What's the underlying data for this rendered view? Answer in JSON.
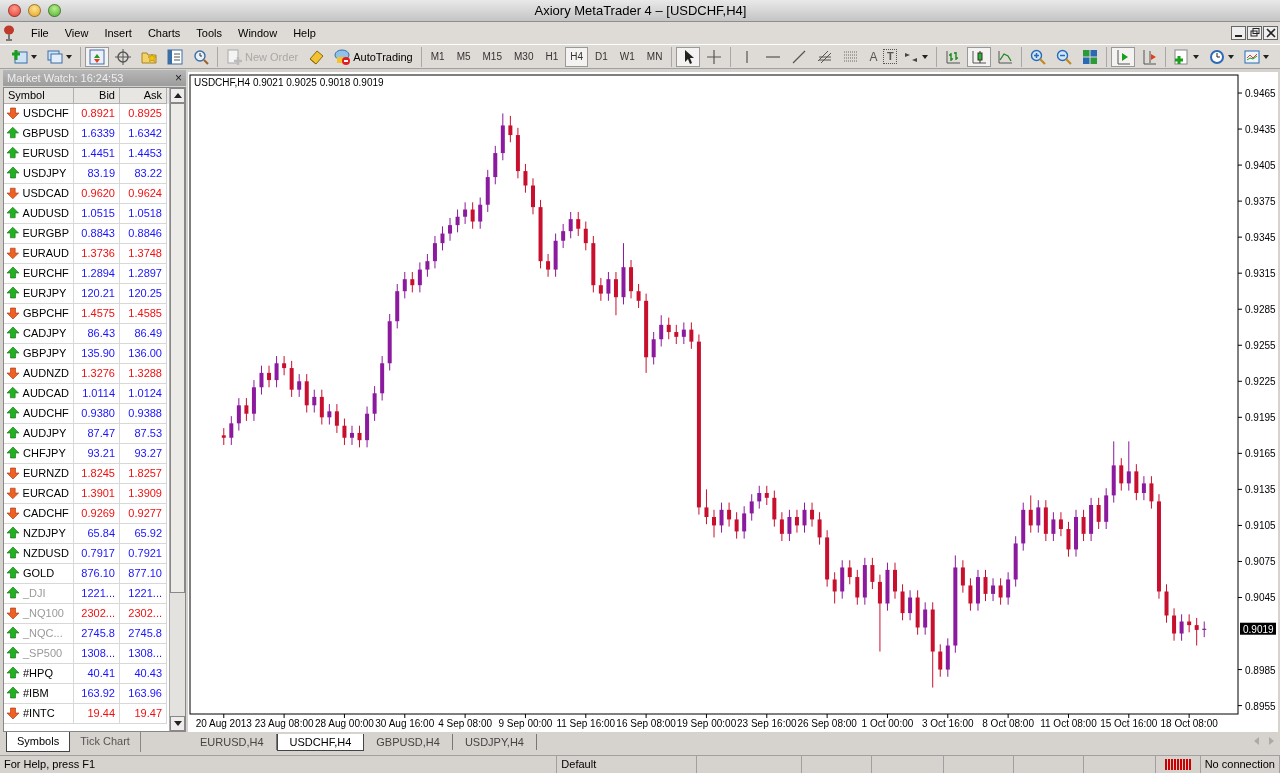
{
  "window": {
    "title": "Axiory MetaTrader 4 – [USDCHF,H4]"
  },
  "menu": [
    "File",
    "View",
    "Insert",
    "Charts",
    "Tools",
    "Window",
    "Help"
  ],
  "toolbar": [
    [
      {
        "kind": "new_chart",
        "dropdown": true,
        "pressed": false
      },
      {
        "kind": "profiles",
        "dropdown": true,
        "pressed": false
      }
    ],
    [
      {
        "kind": "market_watch",
        "pressed": true
      },
      {
        "kind": "data_window",
        "pressed": false
      },
      {
        "kind": "navigator",
        "pressed": false
      },
      {
        "kind": "terminal",
        "pressed": false
      },
      {
        "kind": "tester",
        "pressed": false
      }
    ],
    [
      {
        "kind": "new_order",
        "label": "New Order",
        "disabled": true
      },
      {
        "kind": "editor",
        "pressed": false
      },
      {
        "kind": "autotrading",
        "label": "AutoTrading",
        "disabled": false
      }
    ],
    [
      {
        "kind": "timeframe",
        "label": "M1",
        "selected": false
      },
      {
        "kind": "timeframe",
        "label": "M5",
        "selected": false
      },
      {
        "kind": "timeframe",
        "label": "M15",
        "selected": false
      },
      {
        "kind": "timeframe",
        "label": "M30",
        "selected": false
      },
      {
        "kind": "timeframe",
        "label": "H1",
        "selected": false
      },
      {
        "kind": "timeframe",
        "label": "H4",
        "selected": true
      },
      {
        "kind": "timeframe",
        "label": "D1",
        "selected": false
      },
      {
        "kind": "timeframe",
        "label": "W1",
        "selected": false
      },
      {
        "kind": "timeframe",
        "label": "MN",
        "selected": false
      }
    ],
    [
      {
        "kind": "cursor",
        "pressed": true
      },
      {
        "kind": "crosshair",
        "pressed": false
      }
    ],
    [
      {
        "kind": "vertical_line",
        "pressed": false
      },
      {
        "kind": "horizontal_line",
        "pressed": false
      },
      {
        "kind": "trendline",
        "pressed": false
      },
      {
        "kind": "channel",
        "pressed": false
      },
      {
        "kind": "levels",
        "pressed": false
      },
      {
        "kind": "text_label",
        "label": "A"
      },
      {
        "kind": "text_box",
        "label": "T"
      },
      {
        "kind": "arrows",
        "dropdown": true,
        "pressed": false
      }
    ],
    [
      {
        "kind": "bar_chart",
        "pressed": false
      },
      {
        "kind": "candlesticks",
        "pressed": true
      },
      {
        "kind": "line_chart",
        "pressed": false
      }
    ],
    [
      {
        "kind": "zoom_in",
        "pressed": false
      },
      {
        "kind": "zoom_out",
        "pressed": false
      },
      {
        "kind": "tile",
        "pressed": false
      }
    ],
    [
      {
        "kind": "chart_shift",
        "pressed": true
      },
      {
        "kind": "autoscroll",
        "pressed": false
      }
    ],
    [
      {
        "kind": "indicators",
        "dropdown": true,
        "pressed": false
      },
      {
        "kind": "periods",
        "dropdown": true,
        "pressed": false
      },
      {
        "kind": "templates",
        "dropdown": true,
        "pressed": false
      }
    ]
  ],
  "market_watch": {
    "title": "Market Watch: 16:24:53",
    "close": "×",
    "columns": [
      "Symbol",
      "Bid",
      "Ask"
    ],
    "rows": [
      {
        "symbol": "USDCHF",
        "bid": "0.8921",
        "ask": "0.8925",
        "up": false,
        "disabled": false
      },
      {
        "symbol": "GBPUSD",
        "bid": "1.6339",
        "ask": "1.6342",
        "up": true,
        "disabled": false
      },
      {
        "symbol": "EURUSD",
        "bid": "1.4451",
        "ask": "1.4453",
        "up": true,
        "disabled": false
      },
      {
        "symbol": "USDJPY",
        "bid": "83.19",
        "ask": "83.22",
        "up": true,
        "disabled": false
      },
      {
        "symbol": "USDCAD",
        "bid": "0.9620",
        "ask": "0.9624",
        "up": false,
        "disabled": false
      },
      {
        "symbol": "AUDUSD",
        "bid": "1.0515",
        "ask": "1.0518",
        "up": true,
        "disabled": false
      },
      {
        "symbol": "EURGBP",
        "bid": "0.8843",
        "ask": "0.8846",
        "up": true,
        "disabled": false
      },
      {
        "symbol": "EURAUD",
        "bid": "1.3736",
        "ask": "1.3748",
        "up": false,
        "disabled": false
      },
      {
        "symbol": "EURCHF",
        "bid": "1.2894",
        "ask": "1.2897",
        "up": true,
        "disabled": false
      },
      {
        "symbol": "EURJPY",
        "bid": "120.21",
        "ask": "120.25",
        "up": true,
        "disabled": false
      },
      {
        "symbol": "GBPCHF",
        "bid": "1.4575",
        "ask": "1.4585",
        "up": false,
        "disabled": false
      },
      {
        "symbol": "CADJPY",
        "bid": "86.43",
        "ask": "86.49",
        "up": true,
        "disabled": false
      },
      {
        "symbol": "GBPJPY",
        "bid": "135.90",
        "ask": "136.00",
        "up": true,
        "disabled": false
      },
      {
        "symbol": "AUDNZD",
        "bid": "1.3276",
        "ask": "1.3288",
        "up": false,
        "disabled": false
      },
      {
        "symbol": "AUDCAD",
        "bid": "1.0114",
        "ask": "1.0124",
        "up": true,
        "disabled": false
      },
      {
        "symbol": "AUDCHF",
        "bid": "0.9380",
        "ask": "0.9388",
        "up": true,
        "disabled": false
      },
      {
        "symbol": "AUDJPY",
        "bid": "87.47",
        "ask": "87.53",
        "up": true,
        "disabled": false
      },
      {
        "symbol": "CHFJPY",
        "bid": "93.21",
        "ask": "93.27",
        "up": true,
        "disabled": false
      },
      {
        "symbol": "EURNZD",
        "bid": "1.8245",
        "ask": "1.8257",
        "up": false,
        "disabled": false
      },
      {
        "symbol": "EURCAD",
        "bid": "1.3901",
        "ask": "1.3909",
        "up": false,
        "disabled": false
      },
      {
        "symbol": "CADCHF",
        "bid": "0.9269",
        "ask": "0.9277",
        "up": false,
        "disabled": false
      },
      {
        "symbol": "NZDJPY",
        "bid": "65.84",
        "ask": "65.92",
        "up": true,
        "disabled": false
      },
      {
        "symbol": "NZDUSD",
        "bid": "0.7917",
        "ask": "0.7921",
        "up": true,
        "disabled": false
      },
      {
        "symbol": "GOLD",
        "bid": "876.10",
        "ask": "877.10",
        "up": true,
        "disabled": false
      },
      {
        "symbol": "_DJI",
        "bid": "1221...",
        "ask": "1221...",
        "up": true,
        "disabled": true
      },
      {
        "symbol": "_NQ100",
        "bid": "2302...",
        "ask": "2302...",
        "up": false,
        "disabled": true
      },
      {
        "symbol": "_NQC...",
        "bid": "2745.8",
        "ask": "2745.8",
        "up": true,
        "disabled": true
      },
      {
        "symbol": "_SP500",
        "bid": "1308...",
        "ask": "1308...",
        "up": true,
        "disabled": true
      },
      {
        "symbol": "#HPQ",
        "bid": "40.41",
        "ask": "40.43",
        "up": true,
        "disabled": false
      },
      {
        "symbol": "#IBM",
        "bid": "163.92",
        "ask": "163.96",
        "up": true,
        "disabled": false
      },
      {
        "symbol": "#INTC",
        "bid": "19.44",
        "ask": "19.47",
        "up": false,
        "disabled": false
      }
    ],
    "tabs": [
      {
        "label": "Symbols",
        "selected": true
      },
      {
        "label": "Tick Chart",
        "selected": false
      }
    ]
  },
  "chart": {
    "header": "USDCHF,H4  0.9021 0.9025 0.9018 0.9019",
    "last_price": "0.9019",
    "chart_data": {
      "type": "candlestick",
      "categories": [
        "20 Aug 2013",
        null,
        null,
        null,
        null,
        null,
        null,
        null,
        "23 Aug 08:00",
        null,
        null,
        null,
        null,
        null,
        null,
        null,
        "28 Aug 00:00",
        null,
        null,
        null,
        null,
        null,
        null,
        null,
        "30 Aug 16:00",
        null,
        null,
        null,
        null,
        null,
        null,
        null,
        "4 Sep 08:00",
        null,
        null,
        null,
        null,
        null,
        null,
        null,
        "9 Sep 00:00",
        null,
        null,
        null,
        null,
        null,
        null,
        null,
        "11 Sep 16:00",
        null,
        null,
        null,
        null,
        null,
        null,
        null,
        "16 Sep 08:00",
        null,
        null,
        null,
        null,
        null,
        null,
        null,
        "19 Sep 00:00",
        null,
        null,
        null,
        null,
        null,
        null,
        null,
        "23 Sep 16:00",
        null,
        null,
        null,
        null,
        null,
        null,
        null,
        "26 Sep 08:00",
        null,
        null,
        null,
        null,
        null,
        null,
        null,
        "1 Oct 00:00",
        null,
        null,
        null,
        null,
        null,
        null,
        null,
        "3 Oct 16:00",
        null,
        null,
        null,
        null,
        null,
        null,
        null,
        "8 Oct 08:00",
        null,
        null,
        null,
        null,
        null,
        null,
        null,
        "11 Oct 08:00",
        null,
        null,
        null,
        null,
        null,
        null,
        null,
        "15 Oct 16:00",
        null,
        null,
        null,
        null,
        null,
        null,
        null,
        "18 Oct 08:00",
        null,
        null
      ],
      "ylim": [
        0.8948,
        0.948
      ],
      "yticks": [
        0.9465,
        0.9435,
        0.9405,
        0.9375,
        0.9345,
        0.9315,
        0.9285,
        0.9255,
        0.9225,
        0.9195,
        0.9165,
        0.9135,
        0.9105,
        0.9075,
        0.9045,
        0.8985,
        0.8955
      ],
      "ohlc": [
        [
          0.918,
          0.9186,
          0.9172,
          0.9178
        ],
        [
          0.9178,
          0.9196,
          0.9172,
          0.919
        ],
        [
          0.919,
          0.9211,
          0.9184,
          0.9205
        ],
        [
          0.9205,
          0.9211,
          0.9192,
          0.9198
        ],
        [
          0.9198,
          0.9226,
          0.9192,
          0.922
        ],
        [
          0.922,
          0.9238,
          0.9214,
          0.9232
        ],
        [
          0.9232,
          0.9238,
          0.922,
          0.9226
        ],
        [
          0.9226,
          0.9246,
          0.922,
          0.924
        ],
        [
          0.924,
          0.9246,
          0.923,
          0.9236
        ],
        [
          0.9236,
          0.9242,
          0.9212,
          0.9218
        ],
        [
          0.9218,
          0.9231,
          0.9212,
          0.9225
        ],
        [
          0.9225,
          0.9231,
          0.9199,
          0.9205
        ],
        [
          0.9205,
          0.9218,
          0.9199,
          0.9212
        ],
        [
          0.9212,
          0.9218,
          0.9189,
          0.9195
        ],
        [
          0.9195,
          0.9206,
          0.9189,
          0.92
        ],
        [
          0.92,
          0.9206,
          0.9182,
          0.9188
        ],
        [
          0.9188,
          0.9194,
          0.9172,
          0.9178
        ],
        [
          0.9178,
          0.9188,
          0.9172,
          0.9182
        ],
        [
          0.9182,
          0.9188,
          0.917,
          0.9176
        ],
        [
          0.9176,
          0.9204,
          0.917,
          0.9198
        ],
        [
          0.9198,
          0.9221,
          0.9192,
          0.9215
        ],
        [
          0.9215,
          0.9246,
          0.9209,
          0.924
        ],
        [
          0.924,
          0.9281,
          0.9234,
          0.9275
        ],
        [
          0.9275,
          0.9306,
          0.9269,
          0.93
        ],
        [
          0.93,
          0.9316,
          0.9294,
          0.931
        ],
        [
          0.931,
          0.9316,
          0.9299,
          0.9305
        ],
        [
          0.9305,
          0.9324,
          0.9299,
          0.9318
        ],
        [
          0.9318,
          0.9331,
          0.9312,
          0.9325
        ],
        [
          0.9325,
          0.9346,
          0.9319,
          0.934
        ],
        [
          0.934,
          0.9354,
          0.9334,
          0.9348
        ],
        [
          0.9348,
          0.9361,
          0.9342,
          0.9355
        ],
        [
          0.9355,
          0.9368,
          0.9349,
          0.9362
        ],
        [
          0.9362,
          0.9374,
          0.9356,
          0.9368
        ],
        [
          0.9368,
          0.9374,
          0.9352,
          0.9358
        ],
        [
          0.9358,
          0.9378,
          0.9352,
          0.9372
        ],
        [
          0.9372,
          0.9401,
          0.9366,
          0.9395
        ],
        [
          0.9395,
          0.9421,
          0.9389,
          0.9415
        ],
        [
          0.9415,
          0.9448,
          0.9409,
          0.9438
        ],
        [
          0.9438,
          0.9446,
          0.9424,
          0.943
        ],
        [
          0.943,
          0.9436,
          0.9394,
          0.94
        ],
        [
          0.94,
          0.9406,
          0.9382,
          0.9388
        ],
        [
          0.9388,
          0.9394,
          0.9364,
          0.937
        ],
        [
          0.937,
          0.9376,
          0.9319,
          0.9325
        ],
        [
          0.9325,
          0.9331,
          0.9312,
          0.9318
        ],
        [
          0.9318,
          0.9348,
          0.9312,
          0.9342
        ],
        [
          0.9342,
          0.9356,
          0.9336,
          0.935
        ],
        [
          0.935,
          0.9366,
          0.9344,
          0.936
        ],
        [
          0.936,
          0.9366,
          0.9346,
          0.9352
        ],
        [
          0.9352,
          0.9358,
          0.9334,
          0.934
        ],
        [
          0.934,
          0.9346,
          0.9299,
          0.9305
        ],
        [
          0.9305,
          0.9311,
          0.9292,
          0.9298
        ],
        [
          0.9298,
          0.9316,
          0.9292,
          0.931
        ],
        [
          0.931,
          0.9316,
          0.928,
          0.9295
        ],
        [
          0.9295,
          0.934,
          0.9289,
          0.932
        ],
        [
          0.932,
          0.9326,
          0.9294,
          0.93
        ],
        [
          0.93,
          0.9306,
          0.9286,
          0.9292
        ],
        [
          0.9292,
          0.9298,
          0.9232,
          0.9245
        ],
        [
          0.9245,
          0.9266,
          0.9239,
          0.926
        ],
        [
          0.926,
          0.928,
          0.9254,
          0.9272
        ],
        [
          0.9272,
          0.9278,
          0.926,
          0.9266
        ],
        [
          0.9266,
          0.9272,
          0.9256,
          0.9262
        ],
        [
          0.9262,
          0.9274,
          0.9256,
          0.9268
        ],
        [
          0.9268,
          0.9274,
          0.9252,
          0.9258
        ],
        [
          0.9258,
          0.9264,
          0.9114,
          0.912
        ],
        [
          0.912,
          0.9135,
          0.9106,
          0.9112
        ],
        [
          0.9112,
          0.9118,
          0.9095,
          0.9105
        ],
        [
          0.9105,
          0.9124,
          0.9099,
          0.9118
        ],
        [
          0.9118,
          0.9124,
          0.9104,
          0.911
        ],
        [
          0.911,
          0.9116,
          0.9094,
          0.91
        ],
        [
          0.91,
          0.9121,
          0.9094,
          0.9115
        ],
        [
          0.9115,
          0.9131,
          0.9109,
          0.9125
        ],
        [
          0.9125,
          0.9138,
          0.9119,
          0.9132
        ],
        [
          0.9132,
          0.9138,
          0.9122,
          0.9128
        ],
        [
          0.9128,
          0.9134,
          0.9104,
          0.911
        ],
        [
          0.911,
          0.9116,
          0.9092,
          0.9098
        ],
        [
          0.9098,
          0.9118,
          0.9092,
          0.9112
        ],
        [
          0.9112,
          0.9118,
          0.9099,
          0.9105
        ],
        [
          0.9105,
          0.9124,
          0.9099,
          0.9118
        ],
        [
          0.9118,
          0.9124,
          0.9104,
          0.911
        ],
        [
          0.911,
          0.9116,
          0.9089,
          0.9095
        ],
        [
          0.9095,
          0.9101,
          0.9054,
          0.906
        ],
        [
          0.906,
          0.9066,
          0.904,
          0.905
        ],
        [
          0.905,
          0.9076,
          0.9044,
          0.907
        ],
        [
          0.907,
          0.9076,
          0.9056,
          0.9062
        ],
        [
          0.9062,
          0.9068,
          0.9039,
          0.9045
        ],
        [
          0.9045,
          0.9078,
          0.9039,
          0.9072
        ],
        [
          0.9072,
          0.9078,
          0.9052,
          0.9058
        ],
        [
          0.9058,
          0.9064,
          0.9,
          0.904
        ],
        [
          0.904,
          0.9074,
          0.9034,
          0.9068
        ],
        [
          0.9068,
          0.9074,
          0.9044,
          0.905
        ],
        [
          0.905,
          0.9056,
          0.9026,
          0.9032
        ],
        [
          0.9032,
          0.9051,
          0.9026,
          0.9045
        ],
        [
          0.9045,
          0.9051,
          0.9014,
          0.902
        ],
        [
          0.902,
          0.9041,
          0.9014,
          0.9035
        ],
        [
          0.9035,
          0.9041,
          0.897,
          0.9
        ],
        [
          0.9,
          0.9006,
          0.8979,
          0.8985
        ],
        [
          0.8985,
          0.9011,
          0.8979,
          0.9005
        ],
        [
          0.9005,
          0.908,
          0.8999,
          0.907
        ],
        [
          0.907,
          0.9076,
          0.9049,
          0.9055
        ],
        [
          0.9055,
          0.9061,
          0.9034,
          0.904
        ],
        [
          0.904,
          0.9068,
          0.9034,
          0.9062
        ],
        [
          0.9062,
          0.9068,
          0.9042,
          0.9048
        ],
        [
          0.9048,
          0.9061,
          0.9042,
          0.9055
        ],
        [
          0.9055,
          0.9061,
          0.9039,
          0.9045
        ],
        [
          0.9045,
          0.9066,
          0.9039,
          0.906
        ],
        [
          0.906,
          0.9096,
          0.9054,
          0.909
        ],
        [
          0.909,
          0.9124,
          0.9084,
          0.9118
        ],
        [
          0.9118,
          0.913,
          0.9099,
          0.9105
        ],
        [
          0.9105,
          0.9126,
          0.9099,
          0.912
        ],
        [
          0.912,
          0.9126,
          0.9092,
          0.9098
        ],
        [
          0.9098,
          0.9116,
          0.9092,
          0.911
        ],
        [
          0.911,
          0.9116,
          0.9096,
          0.9102
        ],
        [
          0.9102,
          0.9108,
          0.9079,
          0.9085
        ],
        [
          0.9085,
          0.9118,
          0.9079,
          0.9112
        ],
        [
          0.9112,
          0.9118,
          0.9092,
          0.9098
        ],
        [
          0.9098,
          0.9128,
          0.9092,
          0.9122
        ],
        [
          0.9122,
          0.9128,
          0.9102,
          0.9108
        ],
        [
          0.9108,
          0.9136,
          0.9102,
          0.913
        ],
        [
          0.913,
          0.9175,
          0.9124,
          0.9155
        ],
        [
          0.9155,
          0.9161,
          0.9134,
          0.914
        ],
        [
          0.914,
          0.9175,
          0.9134,
          0.915
        ],
        [
          0.915,
          0.9156,
          0.9126,
          0.9132
        ],
        [
          0.9132,
          0.9146,
          0.9126,
          0.914
        ],
        [
          0.914,
          0.9146,
          0.9119,
          0.9125
        ],
        [
          0.9125,
          0.9131,
          0.9044,
          0.905
        ],
        [
          0.905,
          0.9056,
          0.9024,
          0.903
        ],
        [
          0.903,
          0.9036,
          0.9009,
          0.9015
        ],
        [
          0.9015,
          0.9031,
          0.9009,
          0.9025
        ],
        [
          0.9025,
          0.9031,
          0.9016,
          0.9022
        ],
        [
          0.9022,
          0.9028,
          0.9005,
          0.9018
        ],
        [
          0.9018,
          0.9025,
          0.9012,
          0.9019
        ]
      ]
    }
  },
  "chart_tabs": [
    {
      "label": "EURUSD,H4",
      "selected": false
    },
    {
      "label": "USDCHF,H4",
      "selected": true
    },
    {
      "label": "GBPUSD,H4",
      "selected": false
    },
    {
      "label": "USDJPY,H4",
      "selected": false
    }
  ],
  "status_bar": {
    "help": "For Help, press F1",
    "profile": "Default",
    "connection": "No connection"
  }
}
